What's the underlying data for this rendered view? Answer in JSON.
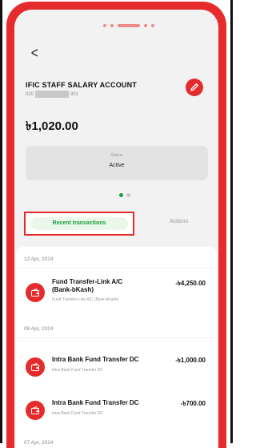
{
  "header": {
    "back_glyph": "<",
    "account_name": "IFIC STAFF SALARY ACCOUNT",
    "account_number_prefix": "020",
    "account_number_suffix": "901",
    "balance": "৳1,020.00"
  },
  "status_card": {
    "label": "Status",
    "value": "Active"
  },
  "pager": {
    "active_index": 0,
    "count": 2
  },
  "tabs": {
    "recent_label": "Recent transactions",
    "actions_label": "Actions"
  },
  "transactions": {
    "groups": [
      {
        "date": "12 Apr, 2024",
        "items": [
          {
            "title_line1": "Fund Transfer-Link A/C",
            "title_line2": "(Bank-bKash)",
            "subtitle": "Fund Transfer-Link A/C (Bank-bKash)",
            "amount": "-৳4,250.00"
          }
        ]
      },
      {
        "date": "08 Apr, 2024",
        "items": [
          {
            "title_line1": "Intra Bank Fund Transfer DC",
            "subtitle": "Intra Bank Fund Transfer DC",
            "amount": "-৳1,000.00"
          },
          {
            "title_line1": "Intra Bank Fund Transfer DC",
            "subtitle": "Intra Bank Fund Transfer DC",
            "amount": "-৳700.00"
          }
        ]
      },
      {
        "date": "07 Apr, 2024"
      }
    ]
  },
  "colors": {
    "brand_red": "#e52b2b",
    "active_green": "#1a9c3a",
    "pager_active": "#1a9c3a",
    "pager_inactive": "#c8c8c8"
  },
  "icons": {
    "back": "chevron-left-icon",
    "edit": "pencil-icon",
    "transaction": "wallet-icon"
  }
}
